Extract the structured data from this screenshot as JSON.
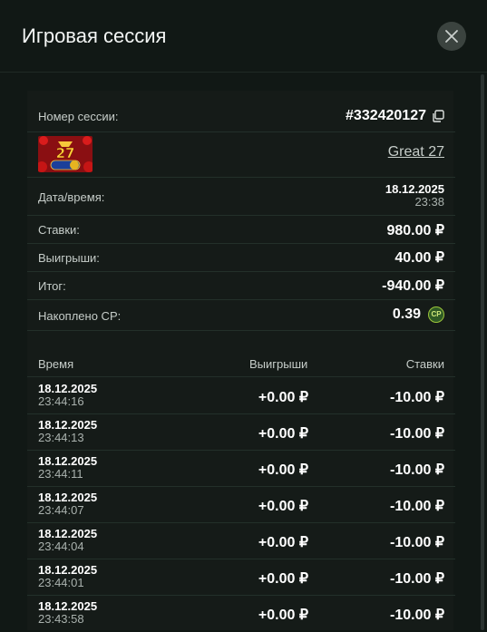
{
  "header": {
    "title": "Игровая сессия"
  },
  "session": {
    "id_label": "Номер сессии:",
    "id_value": "#332420127",
    "game_name": "Great 27",
    "datetime_label": "Дата/время:",
    "date": "18.12.2025",
    "time": "23:38",
    "bets_label": "Ставки:",
    "bets_value": "980.00 ₽",
    "wins_label": "Выигрыши:",
    "wins_value": "40.00 ₽",
    "total_label": "Итог:",
    "total_value": "-940.00 ₽",
    "cp_label": "Накоплено CP:",
    "cp_value": "0.39",
    "cp_badge": "CP"
  },
  "table": {
    "col_time": "Время",
    "col_wins": "Выигрыши",
    "col_bets": "Ставки",
    "rows": [
      {
        "date": "18.12.2025",
        "time": "23:44:16",
        "win": "+0.00 ₽",
        "bet": "-10.00 ₽"
      },
      {
        "date": "18.12.2025",
        "time": "23:44:13",
        "win": "+0.00 ₽",
        "bet": "-10.00 ₽"
      },
      {
        "date": "18.12.2025",
        "time": "23:44:11",
        "win": "+0.00 ₽",
        "bet": "-10.00 ₽"
      },
      {
        "date": "18.12.2025",
        "time": "23:44:07",
        "win": "+0.00 ₽",
        "bet": "-10.00 ₽"
      },
      {
        "date": "18.12.2025",
        "time": "23:44:04",
        "win": "+0.00 ₽",
        "bet": "-10.00 ₽"
      },
      {
        "date": "18.12.2025",
        "time": "23:44:01",
        "win": "+0.00 ₽",
        "bet": "-10.00 ₽"
      },
      {
        "date": "18.12.2025",
        "time": "23:43:58",
        "win": "+0.00 ₽",
        "bet": "-10.00 ₽"
      }
    ]
  },
  "colors": {
    "background": "#111815",
    "card": "#151b18",
    "divider": "#23302a",
    "cp_accent": "#9bc43a"
  },
  "icons": {
    "close": "close-icon",
    "copy": "copy-icon",
    "cp": "cp-coin-icon"
  }
}
